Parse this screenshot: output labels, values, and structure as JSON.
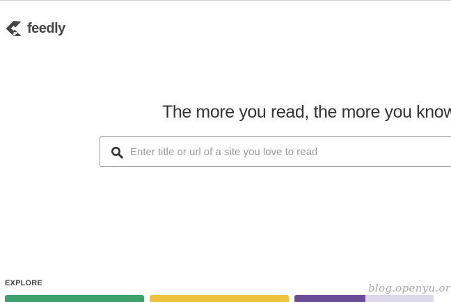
{
  "app": {
    "logo_text": "feedly"
  },
  "hero": {
    "headline": "The more you read, the more you know"
  },
  "search": {
    "value": "",
    "placeholder": "Enter title or url of a site you love to read"
  },
  "explore": {
    "label": "EXPLORE",
    "tiles": [
      {
        "color": "#3ea06a"
      },
      {
        "color": "#eec23c"
      },
      {
        "color": "#6a4d96",
        "accent_color": "#ddd7ea"
      }
    ]
  },
  "watermark": {
    "text": "blog.openyu.org"
  },
  "colors": {
    "text_dark": "#333333",
    "placeholder": "#9b9b9b",
    "border": "#9a9a9a"
  }
}
